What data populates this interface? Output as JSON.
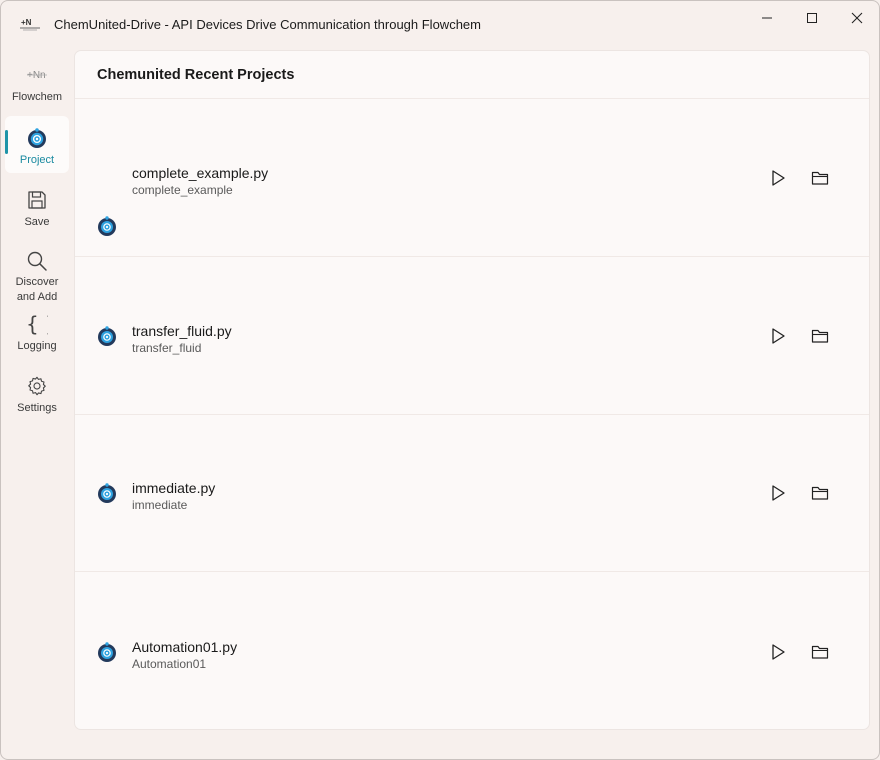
{
  "window": {
    "title": "ChemUnited-Drive - API Devices Drive Communication through Flowchem"
  },
  "sidebar": {
    "items": [
      {
        "label": "Flowchem",
        "icon": "flowchem-logo-icon",
        "active": false
      },
      {
        "label": "Project",
        "icon": "project-gear-icon",
        "active": true
      },
      {
        "label": "Save",
        "icon": "save-icon",
        "active": false
      },
      {
        "label": "Discover and Add",
        "icon": "search-icon",
        "active": false
      },
      {
        "label": "Logging",
        "icon": "braces-icon",
        "active": false
      },
      {
        "label": "Settings",
        "icon": "gear-icon",
        "active": false
      }
    ]
  },
  "main": {
    "title": "Chemunited Recent Projects",
    "projects": [
      {
        "name": "complete_example.py",
        "subtitle": "complete_example"
      },
      {
        "name": "transfer_fluid.py",
        "subtitle": "transfer_fluid"
      },
      {
        "name": "immediate.py",
        "subtitle": "immediate"
      },
      {
        "name": "Automation01.py",
        "subtitle": "Automation01"
      }
    ]
  },
  "colors": {
    "accent": "#1f94a8",
    "background": "#f7f0ed",
    "card": "#fcf9f8"
  }
}
